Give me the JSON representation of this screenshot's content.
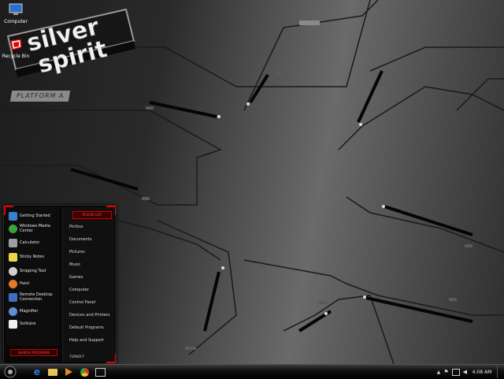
{
  "desktop": {
    "icons": [
      {
        "label": "Computer",
        "icon": "computer-icon"
      },
      {
        "label": "Recycle Bin",
        "icon": "recycle-bin-icon"
      }
    ]
  },
  "wallpaper": {
    "platform_label": "PLATFORM A",
    "logo_line1": "silver",
    "logo_line2": "spirit"
  },
  "start_menu": {
    "user_label": "PLEASE LIST",
    "programs": [
      {
        "label": "Getting Started",
        "icon": "getting-started-icon",
        "color": "#3b7fd0"
      },
      {
        "label": "Windows Media Center",
        "icon": "media-center-icon",
        "color": "#3aa23a"
      },
      {
        "label": "Calculator",
        "icon": "calculator-icon",
        "color": "#9aa0a8"
      },
      {
        "label": "Sticky Notes",
        "icon": "sticky-notes-icon",
        "color": "#e8d74a"
      },
      {
        "label": "Snipping Tool",
        "icon": "snipping-tool-icon",
        "color": "#cfcfcf"
      },
      {
        "label": "Paint",
        "icon": "paint-icon",
        "color": "#e07a2e"
      },
      {
        "label": "Remote Desktop Connection",
        "icon": "remote-desktop-icon",
        "color": "#3d6fbf"
      },
      {
        "label": "Magnifier",
        "icon": "magnifier-icon",
        "color": "#5f8fd0"
      },
      {
        "label": "Solitaire",
        "icon": "solitaire-icon",
        "color": "#f0f0f0"
      }
    ],
    "places": [
      "Pinfoss",
      "Documents",
      "Pictures",
      "Music",
      "Games",
      "Computer",
      "Control Panel",
      "Devices and Printers",
      "Default Programs",
      "Help and Support"
    ],
    "search_label": "SEARCH PROGRAMS",
    "shutdown_label": "TURNOFF"
  },
  "taskbar": {
    "pinned": [
      {
        "name": "internet-explorer-icon",
        "color": "#2a7ad9"
      },
      {
        "name": "file-explorer-icon",
        "color": "#e5c55a"
      },
      {
        "name": "media-player-icon",
        "color": "#e8852a"
      },
      {
        "name": "chrome-icon",
        "color": "#d23b2b"
      },
      {
        "name": "paint-app-icon",
        "color": "#cccccc"
      }
    ],
    "clock": "4:08 AM"
  },
  "colors": {
    "accent": "#e00000",
    "taskbar": "#111111"
  }
}
